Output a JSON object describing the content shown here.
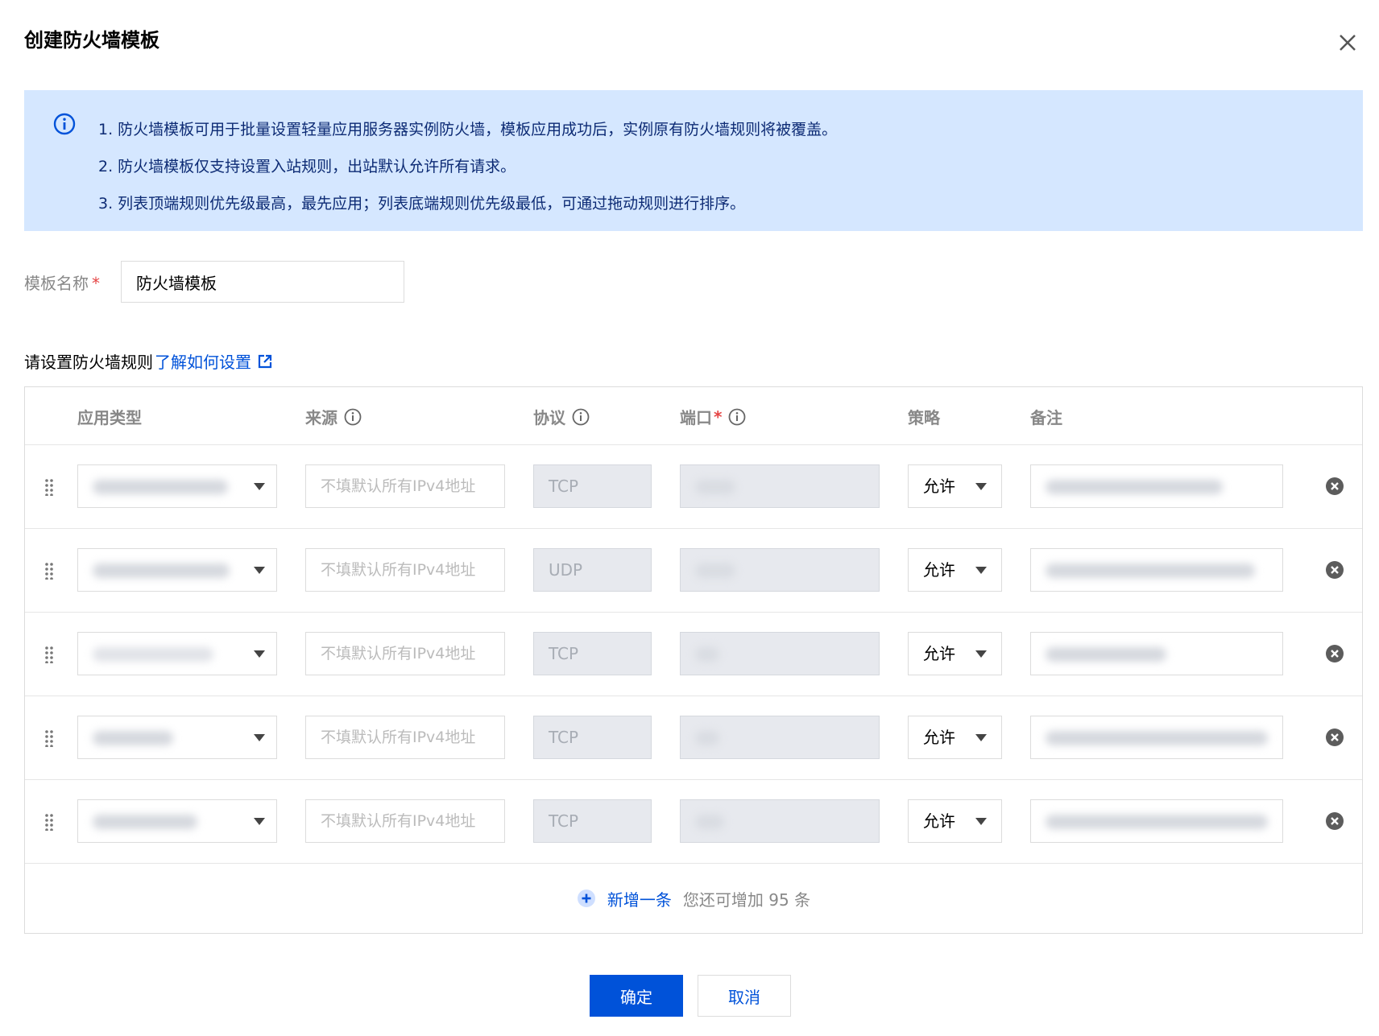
{
  "dialog": {
    "title": "创建防火墙模板"
  },
  "notice": {
    "lines": [
      "1. 防火墙模板可用于批量设置轻量应用服务器实例防火墙，模板应用成功后，实例原有防火墙规则将被覆盖。",
      "2. 防火墙模板仅支持设置入站规则，出站默认允许所有请求。",
      "3. 列表顶端规则优先级最高，最先应用；列表底端规则优先级最低，可通过拖动规则进行排序。"
    ]
  },
  "template_name": {
    "label": "模板名称",
    "required_mark": "*",
    "value": "防火墙模板"
  },
  "rules_section": {
    "prompt": "请设置防火墙规则",
    "help_link": "了解如何设置"
  },
  "table": {
    "headers": {
      "app_type": "应用类型",
      "source": "来源",
      "protocol": "协议",
      "port": "端口",
      "port_required": "*",
      "policy": "策略",
      "remark": "备注"
    },
    "source_placeholder": "不填默认所有IPv4地址",
    "rows": [
      {
        "protocol": "TCP",
        "policy": "允许"
      },
      {
        "protocol": "UDP",
        "policy": "允许"
      },
      {
        "protocol": "TCP",
        "policy": "允许"
      },
      {
        "protocol": "TCP",
        "policy": "允许"
      },
      {
        "protocol": "TCP",
        "policy": "允许"
      }
    ]
  },
  "add_rule": {
    "label": "新增一条",
    "hint": "您还可增加 95 条"
  },
  "footer": {
    "confirm": "确定",
    "cancel": "取消"
  },
  "colors": {
    "primary": "#0052d9",
    "notice_bg": "#d5e7ff",
    "notice_text": "#0d2b74",
    "required": "#e54545",
    "disabled_bg": "#e7e9ee"
  }
}
